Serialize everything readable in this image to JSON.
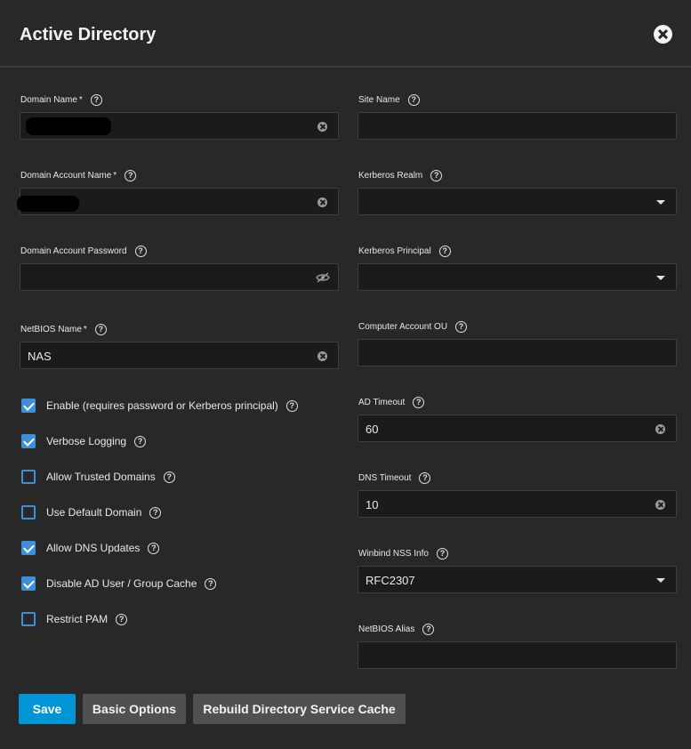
{
  "dialog": {
    "title": "Active Directory"
  },
  "left_fields": {
    "domain_name": {
      "label": "Domain Name",
      "required": "*",
      "value": ""
    },
    "domain_account_name": {
      "label": "Domain Account Name",
      "required": "*",
      "value": ""
    },
    "domain_account_password": {
      "label": "Domain Account Password",
      "value": ""
    },
    "netbios_name": {
      "label": "NetBIOS Name",
      "required": "*",
      "value": "NAS"
    }
  },
  "right_fields": {
    "site_name": {
      "label": "Site Name",
      "value": ""
    },
    "kerberos_realm": {
      "label": "Kerberos Realm",
      "value": ""
    },
    "kerberos_principal": {
      "label": "Kerberos Principal",
      "value": ""
    },
    "computer_account_ou": {
      "label": "Computer Account OU",
      "value": ""
    },
    "ad_timeout": {
      "label": "AD Timeout",
      "value": "60"
    },
    "dns_timeout": {
      "label": "DNS Timeout",
      "value": "10"
    },
    "winbind_nss_info": {
      "label": "Winbind NSS Info",
      "value": "RFC2307"
    },
    "netbios_alias": {
      "label": "NetBIOS Alias",
      "value": ""
    }
  },
  "checkboxes": [
    {
      "label": "Enable (requires password or Kerberos principal)",
      "checked": true
    },
    {
      "label": "Verbose Logging",
      "checked": true
    },
    {
      "label": "Allow Trusted Domains",
      "checked": false
    },
    {
      "label": "Use Default Domain",
      "checked": false
    },
    {
      "label": "Allow DNS Updates",
      "checked": true
    },
    {
      "label": "Disable AD User / Group Cache",
      "checked": true
    },
    {
      "label": "Restrict PAM",
      "checked": false
    }
  ],
  "buttons": {
    "save": "Save",
    "basic_options": "Basic Options",
    "rebuild_cache": "Rebuild Directory Service Cache"
  },
  "help_glyph": "?",
  "colors": {
    "background": "#282828",
    "input_background": "#1b1b1b",
    "accent": "#0095d5",
    "checkbox": "#3d8fd9",
    "secondary_button": "#505050"
  }
}
